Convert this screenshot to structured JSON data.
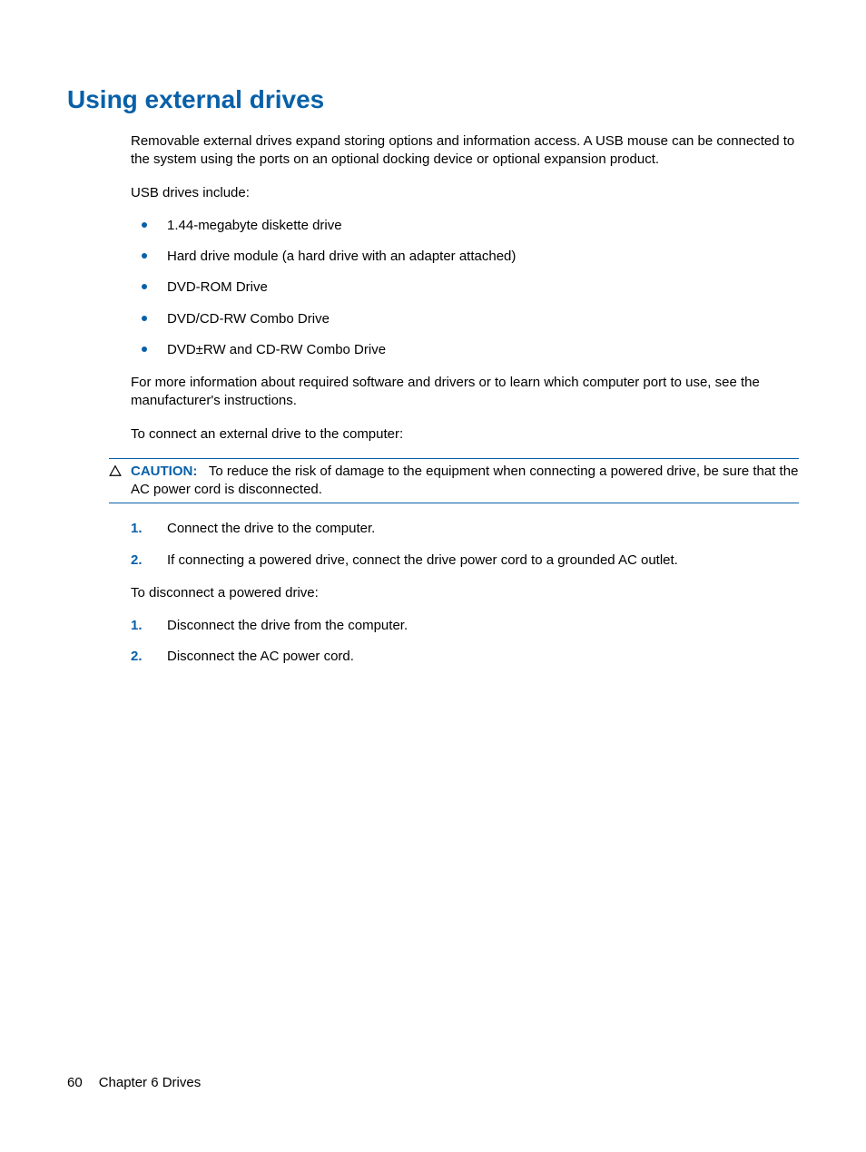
{
  "heading": "Using external drives",
  "intro": "Removable external drives expand storing options and information access. A USB mouse can be connected to the system using the ports on an optional docking device or optional expansion product.",
  "usb_lead": "USB drives include:",
  "usb_list": [
    "1.44-megabyte diskette drive",
    "Hard drive module (a hard drive with an adapter attached)",
    "DVD-ROM Drive",
    "DVD/CD-RW Combo Drive",
    "DVD±RW and CD-RW Combo Drive"
  ],
  "more_info": "For more information about required software and drivers or to learn which computer port to use, see the manufacturer's instructions.",
  "connect_lead": "To connect an external drive to the computer:",
  "caution": {
    "label": "CAUTION:",
    "text": "To reduce the risk of damage to the equipment when connecting a powered drive, be sure that the AC power cord is disconnected."
  },
  "connect_steps": [
    "Connect the drive to the computer.",
    "If connecting a powered drive, connect the drive power cord to a grounded AC outlet."
  ],
  "disconnect_lead": "To disconnect a powered drive:",
  "disconnect_steps": [
    "Disconnect the drive from the computer.",
    "Disconnect the AC power cord."
  ],
  "footer": {
    "page": "60",
    "chapter": "Chapter 6   Drives"
  }
}
